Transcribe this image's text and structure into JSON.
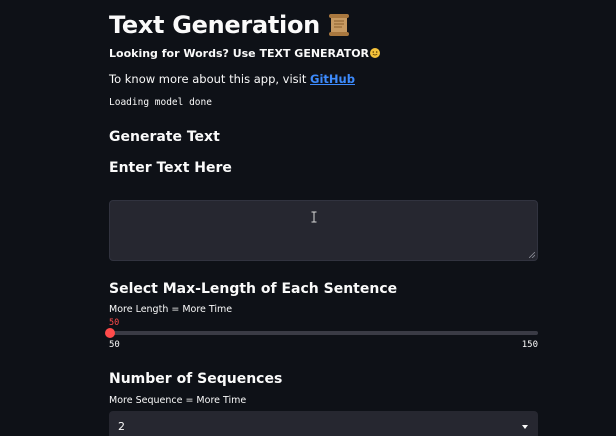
{
  "header": {
    "title": "Text Generation",
    "title_icon": "scroll-icon",
    "tagline": "Looking for Words? Use TEXT GENERATOR",
    "tagline_icon": "smiling-face-icon"
  },
  "info": {
    "prefix": "To know more about this app, visit ",
    "link_text": "GitHub"
  },
  "status_text": "Loading model done",
  "generate_section": {
    "heading": "Generate Text",
    "input_heading": "Enter Text Here",
    "input_value": "",
    "input_placeholder": ""
  },
  "max_length": {
    "heading": "Select Max-Length of Each Sentence",
    "caption": "More Length = More Time",
    "value": 50,
    "value_label": "50",
    "min_label": "50",
    "max_label": "150",
    "min": 50,
    "max": 150
  },
  "sequences": {
    "heading": "Number of Sequences",
    "caption": "More Sequence = More Time",
    "selected": "2"
  },
  "colors": {
    "background": "#0e1117",
    "accent": "#ff4b4b",
    "link": "#3d8bfd",
    "input_bg": "#262730"
  }
}
